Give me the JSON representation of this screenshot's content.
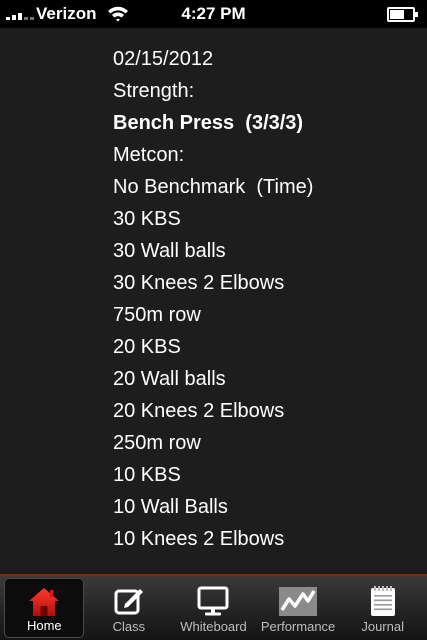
{
  "status_bar": {
    "carrier": "Verizon",
    "time": "4:27 PM"
  },
  "workout": {
    "date": "02/15/2012",
    "lines": [
      {
        "text": "Strength:",
        "bold": false
      },
      {
        "text": "Bench Press  (3/3/3)",
        "bold": true
      },
      {
        "text": "Metcon:",
        "bold": false
      },
      {
        "text": "No Benchmark  (Time)",
        "bold": false
      },
      {
        "text": "30 KBS",
        "bold": false
      },
      {
        "text": "30 Wall balls",
        "bold": false
      },
      {
        "text": "30 Knees 2 Elbows",
        "bold": false
      },
      {
        "text": "750m row",
        "bold": false
      },
      {
        "text": "20 KBS",
        "bold": false
      },
      {
        "text": "20 Wall balls",
        "bold": false
      },
      {
        "text": "20 Knees 2 Elbows",
        "bold": false
      },
      {
        "text": "250m row",
        "bold": false
      },
      {
        "text": "10 KBS",
        "bold": false
      },
      {
        "text": "10 Wall Balls",
        "bold": false
      },
      {
        "text": "10 Knees 2 Elbows",
        "bold": false
      }
    ]
  },
  "tabs": [
    {
      "label": "Home",
      "icon": "home-icon",
      "active": true
    },
    {
      "label": "Class",
      "icon": "edit-icon",
      "active": false
    },
    {
      "label": "Whiteboard",
      "icon": "monitor-icon",
      "active": false
    },
    {
      "label": "Performance",
      "icon": "chart-icon",
      "active": false
    },
    {
      "label": "Journal",
      "icon": "notepad-icon",
      "active": false
    }
  ],
  "colors": {
    "accent": "#e0201b",
    "background": "#1d1d1d",
    "text": "#ffffff"
  }
}
